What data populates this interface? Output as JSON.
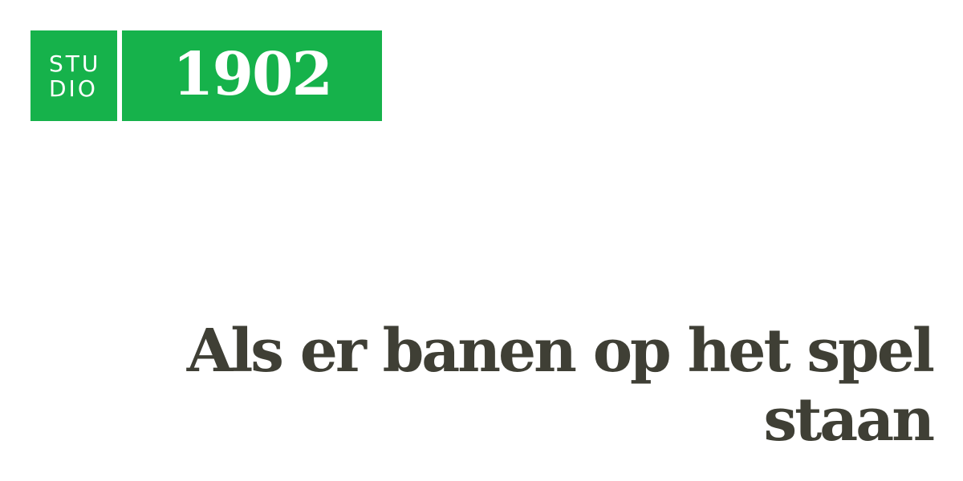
{
  "logo": {
    "studio_line1": "STU",
    "studio_line2": "DIO",
    "number": "1902"
  },
  "headline": {
    "text": "Als er banen op het spel staan"
  },
  "colors": {
    "brand_green": "#16b24b",
    "headline_text": "#3f3f35",
    "background": "#ffffff"
  }
}
